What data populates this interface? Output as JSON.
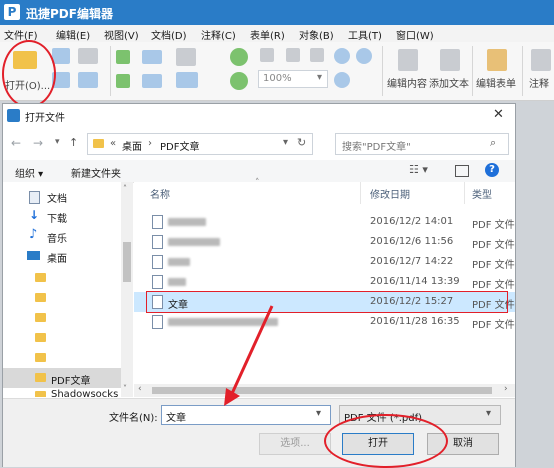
{
  "app": {
    "title": "迅捷PDF编辑器",
    "logo_letter": "P"
  },
  "menu": [
    "文件(F)",
    "编辑(E)",
    "视图(V)",
    "文档(D)",
    "注释(C)",
    "表单(R)",
    "对象(B)",
    "工具(T)",
    "窗口(W)"
  ],
  "ribbon": {
    "open_label": "打开(O)...",
    "zoom_value": "100%",
    "edit_content": "编辑内容",
    "add_text": "添加文本",
    "edit_form": "编辑表单",
    "annotate": "注释"
  },
  "dialog": {
    "title": "打开文件",
    "breadcrumb": {
      "prefix": "«",
      "items": [
        "桌面",
        "PDF文章"
      ],
      "sep": "›"
    },
    "search_placeholder": "搜索\"PDF文章\"",
    "organize": "组织 ▾",
    "new_folder": "新建文件夹",
    "nav_items": [
      {
        "label": "文档",
        "icon": "documents-icon"
      },
      {
        "label": "下载",
        "icon": "download-icon"
      },
      {
        "label": "音乐",
        "icon": "music-icon"
      },
      {
        "label": "桌面",
        "icon": "desktop-icon"
      },
      {
        "label": "PDF文章",
        "icon": "folder-icon"
      },
      {
        "label": "Shadowsocks",
        "icon": "folder-icon"
      }
    ],
    "columns": {
      "name": "名称",
      "date": "修改日期",
      "type": "类型"
    },
    "files": [
      {
        "name": "",
        "date": "2016/12/2 14:01",
        "type": "PDF 文件"
      },
      {
        "name": "",
        "date": "2016/12/6 11:56",
        "type": "PDF 文件"
      },
      {
        "name": "",
        "date": "2016/12/7 14:22",
        "type": "PDF 文件"
      },
      {
        "name": "",
        "date": "2016/11/14 13:39",
        "type": "PDF 文件"
      },
      {
        "name": "文章",
        "date": "2016/12/2 15:27",
        "type": "PDF 文件",
        "selected": true
      },
      {
        "name": "",
        "date": "2016/11/28 16:35",
        "type": "PDF 文件"
      }
    ],
    "filename_label": "文件名(N):",
    "filename_value": "文章",
    "filter_value": "PDF 文件 (*.pdf)",
    "options_btn": "选项...",
    "open_btn": "打开",
    "cancel_btn": "取消"
  },
  "colors": {
    "titlebar": "#2a7cc7",
    "annotation_red": "#e2202a",
    "selection": "#cce8ff",
    "folder": "#f1c24a"
  }
}
